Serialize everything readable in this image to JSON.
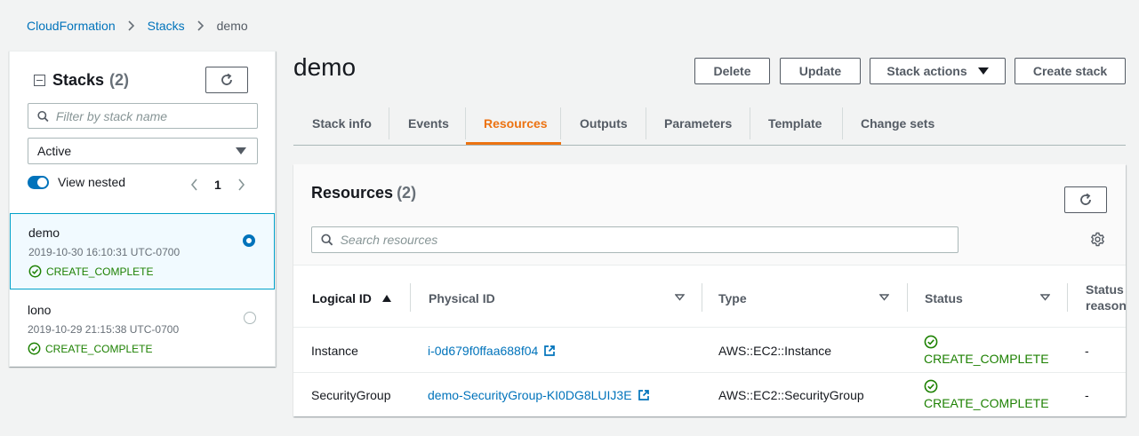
{
  "breadcrumb": {
    "items": [
      "CloudFormation",
      "Stacks"
    ],
    "current": "demo"
  },
  "stacks_panel": {
    "title": "Stacks",
    "count": "(2)",
    "filter_placeholder": "Filter by stack name",
    "status_filter": "Active",
    "view_nested_label": "View nested",
    "page": "1",
    "items": [
      {
        "name": "demo",
        "timestamp": "2019-10-30 16:10:31 UTC-0700",
        "status": "CREATE_COMPLETE",
        "selected": true
      },
      {
        "name": "lono",
        "timestamp": "2019-10-29 21:15:38 UTC-0700",
        "status": "CREATE_COMPLETE",
        "selected": false
      }
    ]
  },
  "page": {
    "title": "demo",
    "buttons": {
      "delete": "Delete",
      "update": "Update",
      "stack_actions": "Stack actions",
      "create_stack": "Create stack"
    }
  },
  "tabs": [
    "Stack info",
    "Events",
    "Resources",
    "Outputs",
    "Parameters",
    "Template",
    "Change sets"
  ],
  "active_tab": "Resources",
  "resources": {
    "title": "Resources",
    "count": "(2)",
    "search_placeholder": "Search resources",
    "columns": [
      "Logical ID",
      "Physical ID",
      "Type",
      "Status",
      "Status reason"
    ],
    "rows": [
      {
        "logical_id": "Instance",
        "physical_id": "i-0d679f0ffaa688f04",
        "type": "AWS::EC2::Instance",
        "status": "CREATE_COMPLETE",
        "status_reason": "-"
      },
      {
        "logical_id": "SecurityGroup",
        "physical_id": "demo-SecurityGroup-KI0DG8LUIJ3E",
        "type": "AWS::EC2::SecurityGroup",
        "status": "CREATE_COMPLETE",
        "status_reason": "-"
      }
    ]
  },
  "colors": {
    "link": "#0073bb",
    "accent_tab": "#ec7211",
    "success": "#1d8102",
    "selected_bg": "#f1faff"
  }
}
